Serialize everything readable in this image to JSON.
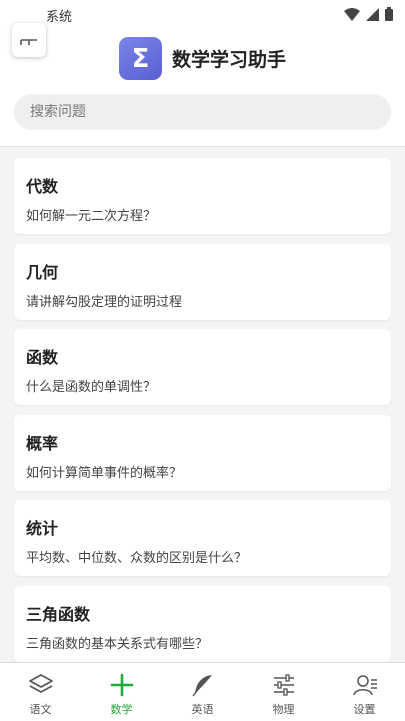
{
  "status": {
    "label": "系统"
  },
  "header": {
    "title": "数学学习助手",
    "logo_glyph": "Σ"
  },
  "search": {
    "placeholder": "搜索问题"
  },
  "topics": [
    {
      "title": "代数",
      "question": "如何解一元二次方程？"
    },
    {
      "title": "几何",
      "question": "请讲解勾股定理的证明过程"
    },
    {
      "title": "函数",
      "question": "什么是函数的单调性？"
    },
    {
      "title": "概率",
      "question": "如何计算简单事件的概率？"
    },
    {
      "title": "统计",
      "question": "平均数、中位数、众数的区别是什么？"
    },
    {
      "title": "三角函数",
      "question": "三角函数的基本关系式有哪些？"
    }
  ],
  "tabs": [
    {
      "label": "语文",
      "icon": "layers-icon"
    },
    {
      "label": "数学",
      "icon": "plus-icon",
      "active": true
    },
    {
      "label": "英语",
      "icon": "feather-icon"
    },
    {
      "label": "物理",
      "icon": "sliders-icon"
    },
    {
      "label": "设置",
      "icon": "user-settings-icon"
    }
  ],
  "colors": {
    "accent": "#22a93a",
    "logo": "#5a5ed4",
    "background": "#f4f4f4"
  }
}
